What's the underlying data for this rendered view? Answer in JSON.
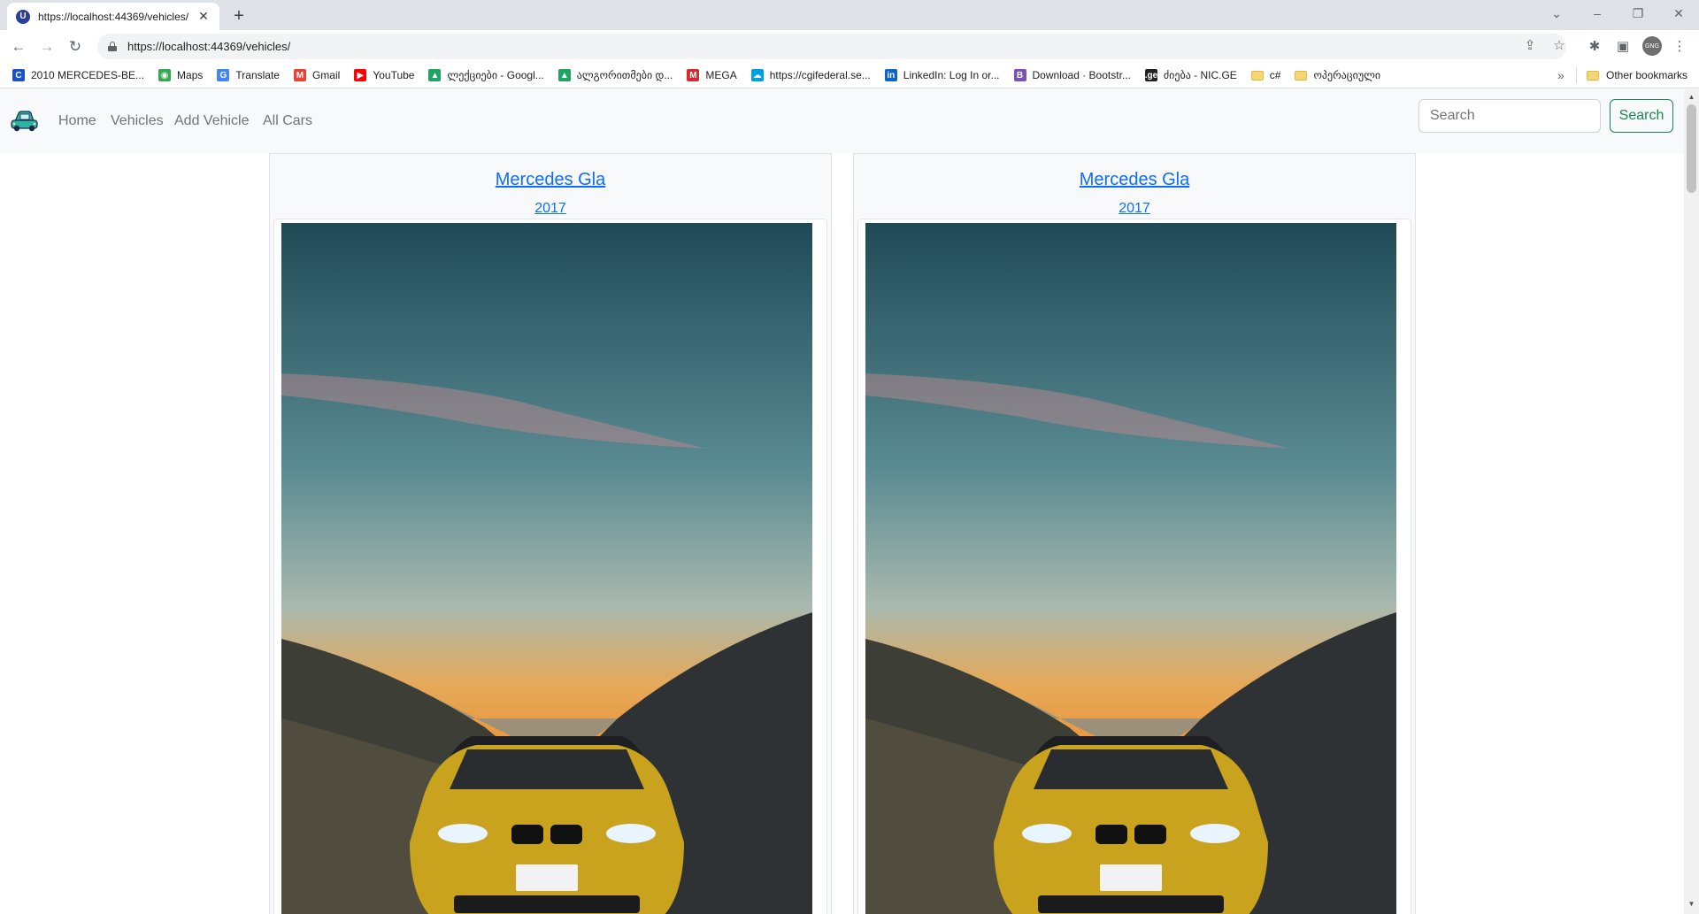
{
  "browser": {
    "tab": {
      "favicon_letter": "U",
      "title": "https://localhost:44369/vehicles/",
      "close_glyph": "✕"
    },
    "new_tab_glyph": "+",
    "window_controls": {
      "tab_search": "⌄",
      "minimize": "–",
      "restore": "❐",
      "close": "✕"
    },
    "nav": {
      "back": "←",
      "forward": "→",
      "reload": "↻"
    },
    "url": "https://localhost:44369/vehicles/",
    "toolbar_icons": {
      "share": "⇪",
      "bookmark_star": "☆",
      "extensions": "✱",
      "side_panel": "▣",
      "menu": "⋮"
    },
    "profile_initials": "GNG",
    "bookmarks": [
      {
        "label": "2010 MERCEDES-BE...",
        "icon": "C",
        "color": "#1a53c8"
      },
      {
        "label": "Maps",
        "icon": "◉",
        "color": "#34a853"
      },
      {
        "label": "Translate",
        "icon": "G",
        "color": "#4285f4"
      },
      {
        "label": "Gmail",
        "icon": "M",
        "color": "#ea4335"
      },
      {
        "label": "YouTube",
        "icon": "▶",
        "color": "#ff0000"
      },
      {
        "label": "ლექციები - Googl...",
        "icon": "▲",
        "color": "#1fa463"
      },
      {
        "label": "ალგორითმები დ...",
        "icon": "▲",
        "color": "#1fa463"
      },
      {
        "label": "MEGA",
        "icon": "M",
        "color": "#d9272e"
      },
      {
        "label": "https://cgifederal.se...",
        "icon": "☁",
        "color": "#00a1e0"
      },
      {
        "label": "LinkedIn: Log In or...",
        "icon": "in",
        "color": "#0a66c2"
      },
      {
        "label": "Download · Bootstr...",
        "icon": "B",
        "color": "#7952b3"
      },
      {
        "label": "ძიება - NIC.GE",
        "icon": ".ge",
        "color": "#222222"
      },
      {
        "label": "c#",
        "icon": "",
        "color": "#f5d675"
      },
      {
        "label": "ოპერაციული",
        "icon": "",
        "color": "#f5d675"
      }
    ],
    "bookmarks_more": "»",
    "other_bookmarks": "Other bookmarks"
  },
  "site": {
    "nav_links": [
      "Home",
      "Vehicles",
      "Add Vehicle",
      "All Cars"
    ],
    "search": {
      "placeholder": "Search",
      "button_label": "Search"
    }
  },
  "vehicles": [
    {
      "title": "Mercedes Gla",
      "year": "2017"
    },
    {
      "title": "Mercedes Gla",
      "year": "2017"
    }
  ],
  "colors": {
    "link": "#0d6efd",
    "success": "#198754",
    "nav_text": "#6c757d",
    "navbar_bg": "#f8f9fa",
    "car_body": "#c9a21e"
  },
  "scrollbar": {
    "up": "▲",
    "down": "▼"
  }
}
